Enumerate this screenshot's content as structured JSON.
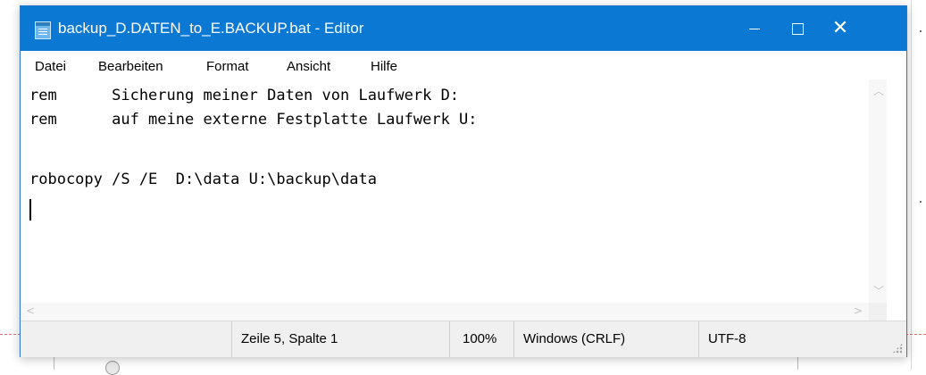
{
  "window": {
    "title": "backup_D.DATEN_to_E.BACKUP.bat - Editor"
  },
  "menu": {
    "items": [
      "Datei",
      "Bearbeiten",
      "Format",
      "Ansicht",
      "Hilfe"
    ]
  },
  "editor": {
    "lines": [
      "rem      Sicherung meiner Daten von Laufwerk D:",
      "rem      auf meine externe Festplatte Laufwerk U:",
      "",
      "robocopy /S /E  D:\\data U:\\backup\\data",
      ""
    ]
  },
  "statusbar": {
    "position": "Zeile 5, Spalte 1",
    "zoom": "100%",
    "line_ending": "Windows (CRLF)",
    "encoding": "UTF-8"
  },
  "icons": {
    "app": "notepad-icon",
    "minimize": "minimize-icon",
    "maximize": "maximize-icon",
    "close": "close-icon"
  },
  "colors": {
    "titlebar": "#0b78d4",
    "statusbar": "#f0f0f0"
  }
}
